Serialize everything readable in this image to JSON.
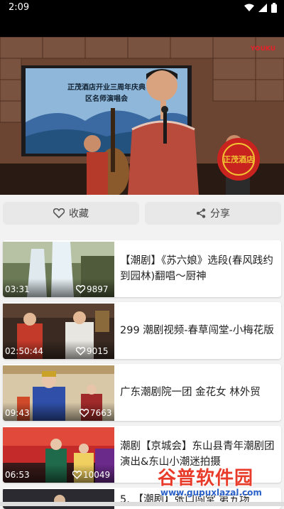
{
  "status_bar": {
    "time": "2:09",
    "icons": [
      "wifi-icon",
      "signal-icon",
      "battery-icon"
    ]
  },
  "video": {
    "brand": "YOUKU",
    "banner_line1": "正茂酒店开业三周年庆典",
    "banner_line2": "区名师演唱会",
    "seal_text": "正茂酒店"
  },
  "actions": {
    "favorite_label": "收藏",
    "share_label": "分享"
  },
  "videos": [
    {
      "duration": "03:31",
      "likes": "9897",
      "title": "【潮剧】《苏六娘》选段(春风践约到园林)翻唱～厨神"
    },
    {
      "duration": "02:50:44",
      "likes": "9015",
      "title": "299 潮剧视频-春草闯堂-小梅花版"
    },
    {
      "duration": "09:43",
      "likes": "7663",
      "title": "广东潮剧院一团  金花女  林外贸"
    },
    {
      "duration": "06:53",
      "likes": "10049",
      "title": "潮剧【京城会】东山县青年潮剧团演出&东山小潮迷拍摄"
    },
    {
      "duration": "",
      "likes": "",
      "title": "5. 【潮剧】张口闯堂  第五场"
    }
  ],
  "watermark": {
    "name": "谷普软件园",
    "url": "www.gupuxlazal.com"
  },
  "colors": {
    "accent_red": "#e2232a",
    "card_bg": "#ffffff",
    "page_bg": "#f2f2f2"
  }
}
